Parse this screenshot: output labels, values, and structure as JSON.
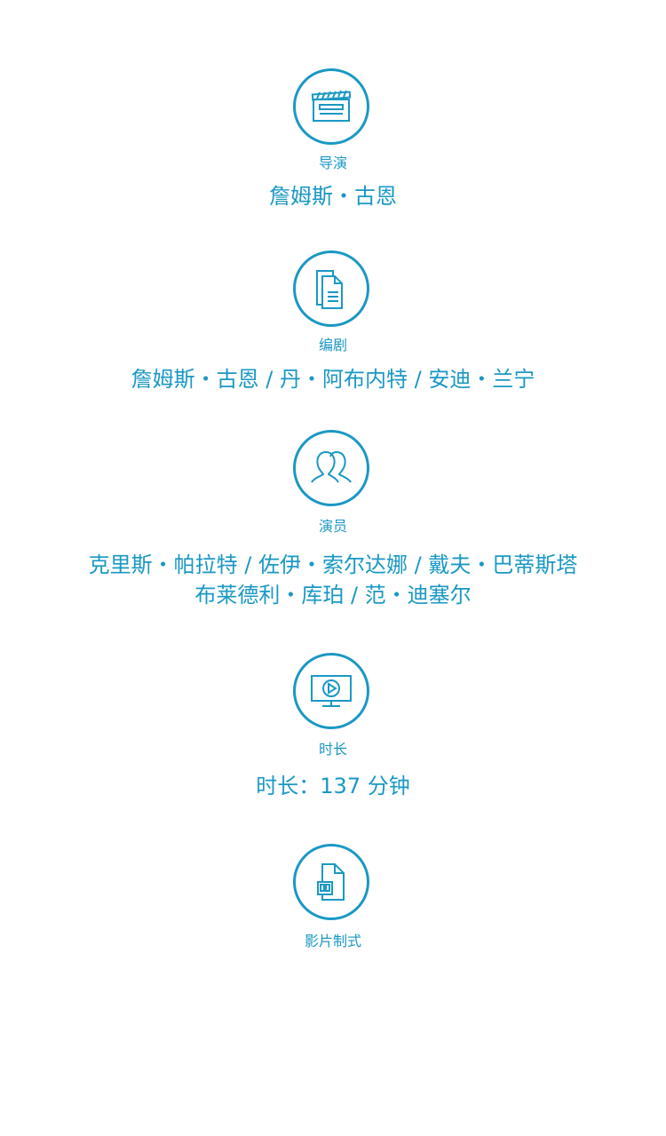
{
  "director": {
    "icon": "clapperboard-icon",
    "label": "导演",
    "value": "詹姆斯・古恩"
  },
  "writer": {
    "icon": "document-icon",
    "label": "编剧",
    "value": "詹姆斯・古恩 / 丹・阿布内特 / 安迪・兰宁"
  },
  "cast": {
    "icon": "people-icon",
    "label": "演员",
    "value_line1": "克里斯・帕拉特 / 佐伊・索尔达娜 / 戴夫・巴蒂斯塔",
    "value_line2": "布莱德利・库珀 / 范・迪塞尔"
  },
  "runtime": {
    "icon": "monitor-play-icon",
    "label": "时长",
    "value": "时长：137 分钟"
  },
  "format": {
    "icon": "film-file-icon",
    "label": "影片制式"
  },
  "colors": {
    "accent": "#1a98c4",
    "background": "#ffffff"
  }
}
